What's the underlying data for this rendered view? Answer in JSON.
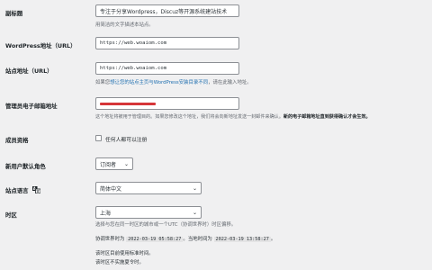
{
  "rows": {
    "tagline": {
      "label": "副标题",
      "value": "专注于分享Wordpress，Discuz等开源系统建站技术",
      "description": "用简洁的文字描述本站点。"
    },
    "wp_url": {
      "label": "WordPress地址（URL）",
      "value": "https://web.woaiom.com"
    },
    "site_url": {
      "label": "站点地址（URL）",
      "value": "https://web.woaiom.com",
      "description_pre": "如果您",
      "description_link": "想让您的站点主页与WordPress安装目录不同",
      "description_post": "，请在此输入地址。"
    },
    "admin_email": {
      "label": "管理员电子邮箱地址",
      "description_pre": "这个地址将被用于管理目的。如果您修改这个地址，我们将会向新地址发送一封邮件来确认。",
      "description_bold": "新的电子邮箱地址直到获得确认才会生效。"
    },
    "membership": {
      "label": "成员资格",
      "checkbox_label": "任何人都可以注册",
      "checked": false
    },
    "default_role": {
      "label": "新用户默认角色",
      "selected": "订阅者"
    },
    "site_language": {
      "label": "站点语言",
      "selected": "简体中文"
    },
    "timezone": {
      "label": "时区",
      "selected": "上海",
      "description": "选择与您在同一时区的城市或一个UTC（协调世界时）时区偏移。",
      "utc_label": "协调世界时为",
      "utc_time": "2022-03-19 05:58:27",
      "local_label": "。当地时间为",
      "local_time": "2022-03-19 13:58:27",
      "local_end": "。",
      "no_dst_1": "该时区目前使用标准时间。",
      "no_dst_2": "该时区不实施夏令时。"
    }
  }
}
